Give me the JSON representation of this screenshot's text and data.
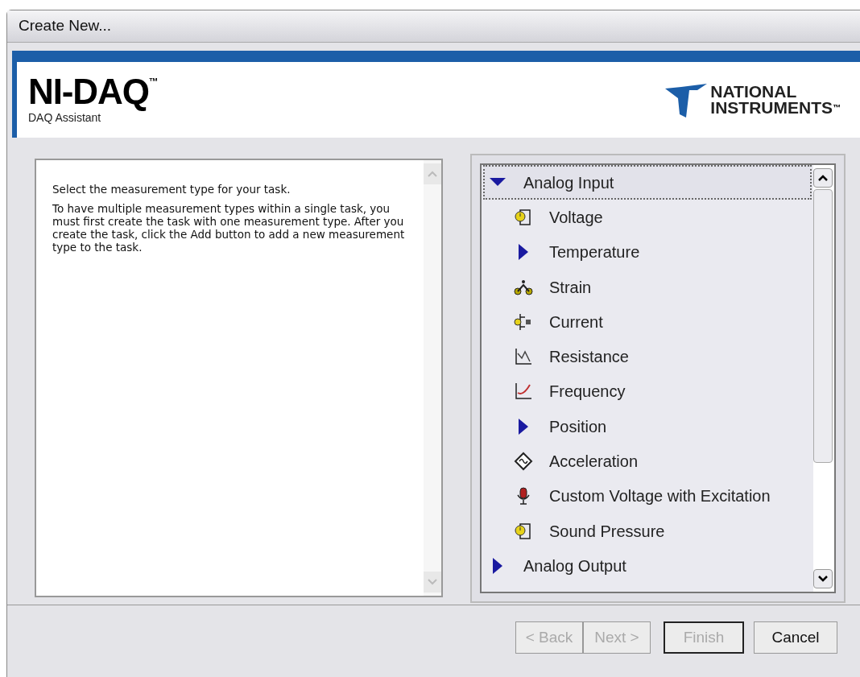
{
  "window": {
    "title": "Create New..."
  },
  "header": {
    "product": "NI-DAQ",
    "trademark": "™",
    "subtitle": "DAQ Assistant",
    "logo_line_1": "NATIONAL",
    "logo_line_2": "INSTRUMENTS",
    "logo_trademark": "™"
  },
  "help_text": [
    "Select the measurement type for your task.",
    "To have multiple measurement types within a single task, you must first create the task with one measurement type. After you create the task, click the Add button to add a new measurement type to the task."
  ],
  "tree": [
    {
      "label": "Analog Input",
      "kind": "group",
      "expanded": true,
      "selected": true,
      "children": [
        {
          "label": "Voltage",
          "kind": "measurement",
          "selected": false
        },
        {
          "label": "Temperature",
          "kind": "group",
          "expanded": false,
          "selected": false
        },
        {
          "label": "Strain",
          "kind": "measurement",
          "selected": false
        },
        {
          "label": "Current",
          "kind": "measurement",
          "selected": false
        },
        {
          "label": "Resistance",
          "kind": "measurement",
          "selected": false
        },
        {
          "label": "Frequency",
          "kind": "measurement",
          "selected": false
        },
        {
          "label": "Position",
          "kind": "group",
          "expanded": false,
          "selected": false
        },
        {
          "label": "Acceleration",
          "kind": "measurement",
          "selected": false
        },
        {
          "label": "Custom Voltage with Excitation",
          "kind": "measurement",
          "selected": false
        },
        {
          "label": "Sound Pressure",
          "kind": "measurement",
          "selected": false
        }
      ]
    },
    {
      "label": "Analog Output",
      "kind": "group",
      "expanded": false,
      "selected": false
    }
  ],
  "buttons": [
    {
      "label": "< Back",
      "disabled": true,
      "default": false
    },
    {
      "label": "Next >",
      "disabled": true,
      "default": false
    },
    {
      "label": "Finish",
      "disabled": true,
      "default": true
    },
    {
      "label": "Cancel",
      "disabled": false,
      "default": false
    }
  ]
}
